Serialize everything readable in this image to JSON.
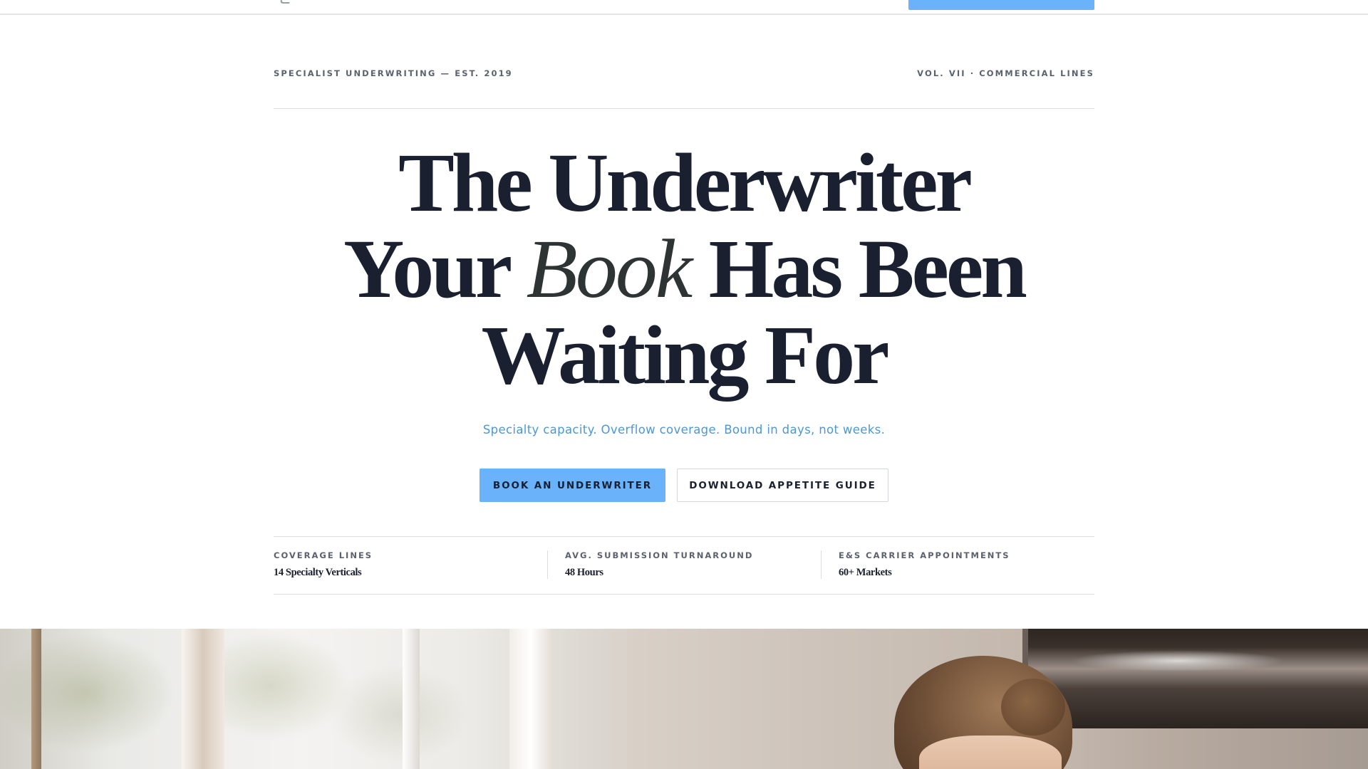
{
  "colors": {
    "accent": "#6ab2f9",
    "heading": "#1a2030",
    "tagline": "#4c97d4",
    "muted": "#5b626d",
    "rule": "#dadde1"
  },
  "nav": {
    "logo_icon": "logo-mark-icon"
  },
  "hero": {
    "eyebrow_left": "SPECIALIST UNDERWRITING — EST. 2019",
    "eyebrow_right": "VOL. VII · COMMERCIAL LINES",
    "title_line1": "The Underwriter",
    "title_line2_pre": "Your ",
    "title_line2_em": "Book",
    "title_line2_post": " Has Been",
    "title_line3": "Waiting For",
    "tagline": "Specialty capacity. Overflow coverage. Bound in days, not weeks.",
    "primary_cta": "BOOK AN UNDERWRITER",
    "secondary_cta": "DOWNLOAD APPETITE GUIDE"
  },
  "stats": [
    {
      "label": "COVERAGE LINES",
      "value": "14 Specialty Verticals"
    },
    {
      "label": "AVG. SUBMISSION TURNAROUND",
      "value": "48 Hours"
    },
    {
      "label": "E&S CARRIER APPOINTMENTS",
      "value": "60+ Markets"
    }
  ]
}
